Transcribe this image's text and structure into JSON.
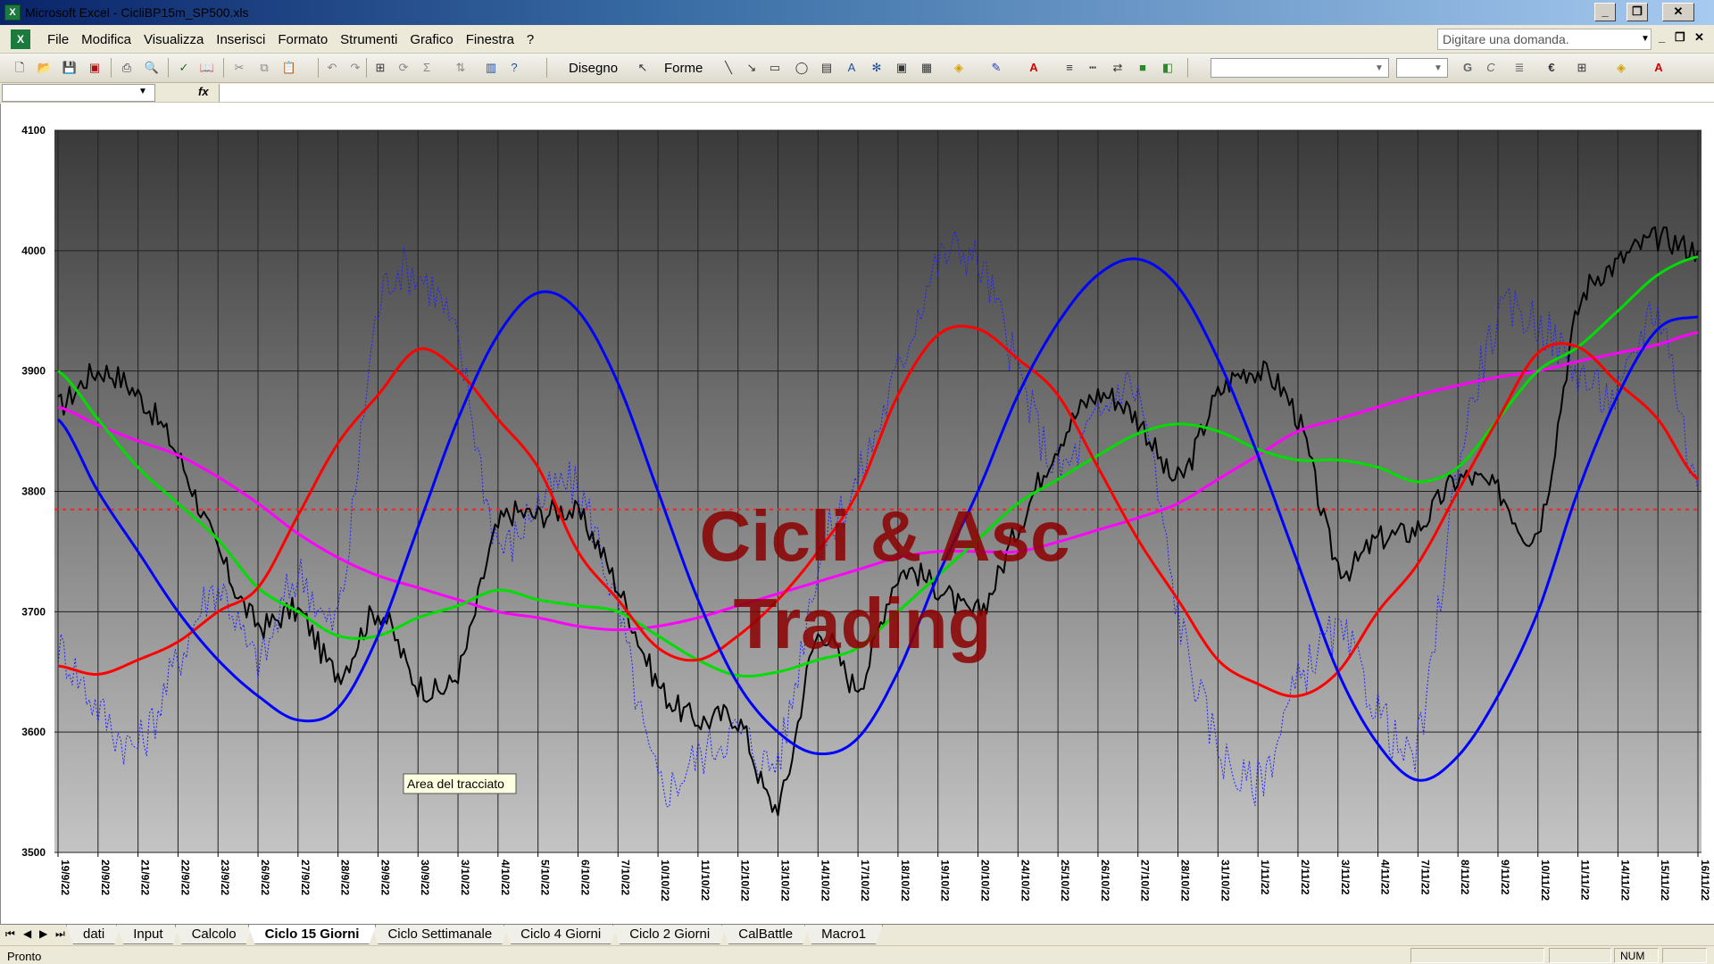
{
  "window": {
    "title": "Microsoft Excel - CicliBP15m_SP500.xls",
    "minimize_label": "_",
    "maximize_label": "❐",
    "close_label": "✕"
  },
  "menubar": {
    "items": [
      "File",
      "Modifica",
      "Visualizza",
      "Inserisci",
      "Formato",
      "Strumenti",
      "Grafico",
      "Finestra",
      "?"
    ],
    "help_placeholder": "Digitare una domanda."
  },
  "toolbar": {
    "drawing_label": "Disegno",
    "shapes_label": "Forme",
    "bold_label": "G",
    "italic_label": "C",
    "euro_label": "€"
  },
  "formulabar": {
    "fx_label": "fx"
  },
  "chart": {
    "watermark_line1": "Cicli & Asc",
    "watermark_line2": "Trading",
    "tooltip": "Area del tracciato"
  },
  "chart_data": {
    "type": "line",
    "ylim": [
      3500,
      4100
    ],
    "yticks": [
      3500,
      3600,
      3700,
      3800,
      3900,
      4000,
      4100
    ],
    "x": [
      "19/9/22",
      "20/9/22",
      "21/9/22",
      "22/9/22",
      "23/9/22",
      "26/9/22",
      "27/9/22",
      "28/9/22",
      "29/9/22",
      "30/9/22",
      "3/10/22",
      "4/10/22",
      "5/10/22",
      "6/10/22",
      "7/10/22",
      "10/10/22",
      "11/10/22",
      "12/10/22",
      "13/10/22",
      "14/10/22",
      "17/10/22",
      "18/10/22",
      "19/10/22",
      "20/10/22",
      "24/10/22",
      "25/10/22",
      "26/10/22",
      "27/10/22",
      "28/10/22",
      "31/10/22",
      "1/11/22",
      "2/11/22",
      "3/11/22",
      "4/11/22",
      "7/11/22",
      "8/11/22",
      "9/11/22",
      "10/11/22",
      "11/11/22",
      "14/11/22",
      "15/11/22",
      "16/11/22"
    ],
    "reference_line": 3785,
    "background": "gradient-dark-to-light-gray",
    "grid": true,
    "series": [
      {
        "color": "#000000",
        "values": [
          3870,
          3900,
          3880,
          3830,
          3750,
          3690,
          3700,
          3650,
          3700,
          3640,
          3650,
          3770,
          3780,
          3780,
          3720,
          3640,
          3610,
          3610,
          3540,
          3680,
          3640,
          3730,
          3720,
          3700,
          3770,
          3840,
          3880,
          3860,
          3810,
          3880,
          3900,
          3860,
          3740,
          3760,
          3770,
          3810,
          3800,
          3770,
          3950,
          3990,
          4010,
          4000
        ]
      },
      {
        "color": "#2020ff",
        "dashed": true,
        "values": [
          3670,
          3620,
          3590,
          3660,
          3720,
          3660,
          3730,
          3700,
          3950,
          3980,
          3920,
          3760,
          3790,
          3800,
          3700,
          3560,
          3580,
          3600,
          3580,
          3740,
          3810,
          3900,
          3990,
          3990,
          3900,
          3820,
          3860,
          3880,
          3700,
          3590,
          3560,
          3640,
          3680,
          3620,
          3590,
          3820,
          3940,
          3940,
          3900,
          3880,
          3950,
          3800
        ]
      },
      {
        "color": "#ff0000",
        "values": [
          3655,
          3648,
          3660,
          3675,
          3700,
          3720,
          3780,
          3840,
          3880,
          3918,
          3900,
          3860,
          3820,
          3750,
          3710,
          3670,
          3660,
          3680,
          3710,
          3750,
          3800,
          3880,
          3930,
          3935,
          3910,
          3880,
          3820,
          3760,
          3710,
          3660,
          3640,
          3630,
          3650,
          3700,
          3740,
          3800,
          3860,
          3915,
          3920,
          3890,
          3860,
          3810
        ]
      },
      {
        "color": "#0000ff",
        "values": [
          3860,
          3800,
          3750,
          3700,
          3660,
          3630,
          3610,
          3620,
          3680,
          3770,
          3860,
          3930,
          3965,
          3950,
          3890,
          3800,
          3710,
          3640,
          3600,
          3582,
          3595,
          3650,
          3730,
          3800,
          3880,
          3940,
          3980,
          3993,
          3970,
          3910,
          3830,
          3740,
          3650,
          3590,
          3560,
          3580,
          3630,
          3700,
          3800,
          3880,
          3935,
          3945
        ]
      },
      {
        "color": "#00dd00",
        "values": [
          3900,
          3860,
          3820,
          3790,
          3760,
          3720,
          3700,
          3680,
          3680,
          3695,
          3705,
          3718,
          3710,
          3705,
          3700,
          3680,
          3660,
          3647,
          3650,
          3660,
          3670,
          3700,
          3730,
          3760,
          3790,
          3810,
          3830,
          3848,
          3856,
          3850,
          3835,
          3826,
          3826,
          3820,
          3808,
          3820,
          3860,
          3900,
          3920,
          3950,
          3980,
          3995
        ]
      },
      {
        "color": "#ff00ff",
        "values": [
          3870,
          3855,
          3842,
          3830,
          3812,
          3790,
          3765,
          3745,
          3730,
          3720,
          3710,
          3700,
          3695,
          3688,
          3685,
          3688,
          3695,
          3705,
          3715,
          3725,
          3735,
          3745,
          3750,
          3750,
          3750,
          3758,
          3768,
          3778,
          3790,
          3810,
          3830,
          3850,
          3860,
          3870,
          3880,
          3888,
          3895,
          3900,
          3908,
          3915,
          3922,
          3932
        ]
      }
    ]
  },
  "sheet_tabs": [
    "dati",
    "Input",
    "Calcolo",
    "Ciclo 15 Giorni",
    "Ciclo Settimanale",
    "Ciclo 4 Giorni",
    "Ciclo 2 Giorni",
    "CalBattle",
    "Macro1"
  ],
  "active_tab": "Ciclo 15 Giorni",
  "status": {
    "text": "Pronto",
    "num_label": "NUM"
  }
}
